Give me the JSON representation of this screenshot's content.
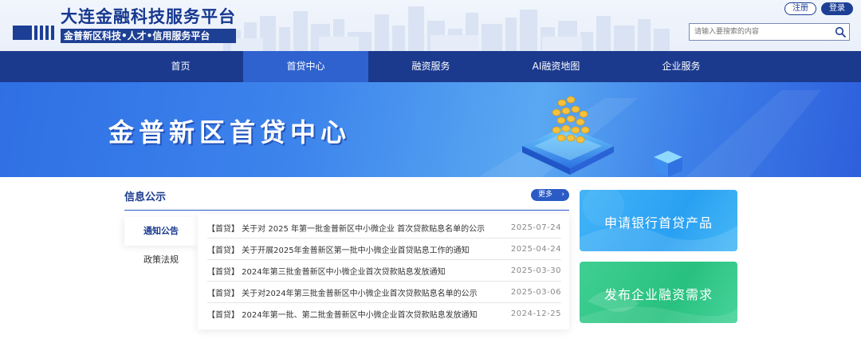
{
  "header": {
    "title": "大连金融科技服务平台",
    "subtitle": "金普新区科技•人才•信用服务平台",
    "register_label": "注册",
    "login_label": "登录",
    "search_placeholder": "请输入要搜索的内容"
  },
  "nav": {
    "items": [
      {
        "label": "首页"
      },
      {
        "label": "首贷中心"
      },
      {
        "label": "融资服务"
      },
      {
        "label": "AI融资地图"
      },
      {
        "label": "企业服务"
      }
    ],
    "active_index": 1
  },
  "banner": {
    "title": "金普新区首贷中心"
  },
  "info": {
    "title": "信息公示",
    "more_label": "更多",
    "tabs": [
      {
        "label": "通知公告"
      },
      {
        "label": "政策法规"
      }
    ],
    "active_tab": 0,
    "notices": [
      {
        "text": "【首贷】 关于对 2025 年第一批金普新区中小微企业 首次贷款贴息名单的公示",
        "date": "2025-07-24"
      },
      {
        "text": "【首贷】 关于开展2025年金普新区第一批中小微企业首贷贴息工作的通知",
        "date": "2025-04-24"
      },
      {
        "text": "【首贷】 2024年第三批金普新区中小微企业首次贷款贴息发放通知",
        "date": "2025-03-30"
      },
      {
        "text": "【首贷】 关于对2024年第三批金普新区中小微企业首次贷款贴息名单的公示",
        "date": "2025-03-06"
      },
      {
        "text": "【首贷】 2024年第一批、第二批金普新区中小微企业首次贷款贴息发放通知",
        "date": "2024-12-25"
      }
    ]
  },
  "cards": {
    "apply_label": "申请银行首贷产品",
    "publish_label": "发布企业融资需求"
  },
  "colors": {
    "primary": "#1b3a8e",
    "nav_active": "#2f62cf",
    "card_blue": "#2aa0f2",
    "card_green": "#29c17f"
  },
  "icons": {
    "search": "search-icon",
    "more": "chevron-right-icon"
  }
}
